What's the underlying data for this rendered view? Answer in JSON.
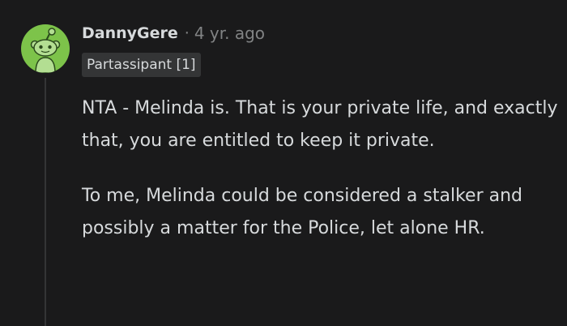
{
  "comment": {
    "author": "DannyGere",
    "separator": "·",
    "timestamp": "4 yr. ago",
    "flair": "Partassipant [1]",
    "paragraphs": [
      "NTA - Melinda is. That is your private life, and exactly that, you are entitled to keep it private.",
      "To me, Melinda could be considered a stalker and possibly a matter for the Police, let alone HR."
    ]
  },
  "colors": {
    "background": "#1a1a1b",
    "text": "#d7dadc",
    "muted": "#818384",
    "flair_bg": "#343536",
    "avatar_bg": "#7dc34a"
  },
  "icons": {
    "avatar": "snoo-avatar-icon"
  }
}
